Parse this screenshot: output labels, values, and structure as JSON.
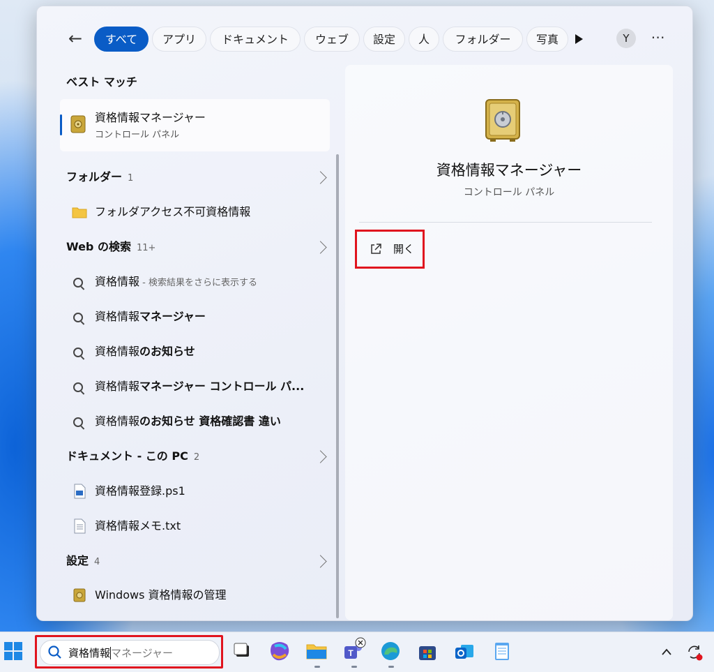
{
  "filters": {
    "back_label": "←",
    "chips": [
      "すべて",
      "アプリ",
      "ドキュメント",
      "ウェブ",
      "設定",
      "人",
      "フォルダー",
      "写真"
    ],
    "avatar": "Y",
    "more": "⋯"
  },
  "results": {
    "best_match_header": "ベスト マッチ",
    "best_match": {
      "name": "資格情報マネージャー",
      "sub": "コントロール パネル"
    },
    "folders": {
      "title": "フォルダー",
      "count": "1",
      "items": [
        "フォルダアクセス不可資格情報"
      ]
    },
    "web": {
      "title": "Web の検索",
      "count": "11+",
      "items": [
        {
          "term": "資格情報",
          "hint": " - 検索結果をさらに表示する"
        },
        {
          "term": "資格情報",
          "bold": "マネージャー"
        },
        {
          "term": "資格情報",
          "bold": "のお知らせ"
        },
        {
          "term": "資格情報",
          "bold": "マネージャー コントロール パ..."
        },
        {
          "term": "資格情報",
          "bold": "のお知らせ 資格確認書 違い"
        }
      ]
    },
    "documents": {
      "title": "ドキュメント - この PC",
      "count": "2",
      "items": [
        "資格情報登録.ps1",
        "資格情報メモ.txt"
      ]
    },
    "settings": {
      "title": "設定",
      "count": "4",
      "items": [
        "Windows 資格情報の管理"
      ]
    }
  },
  "detail": {
    "title": "資格情報マネージャー",
    "sub": "コントロール パネル",
    "open_label": "開く",
    "icon": "safe-icon"
  },
  "taskbar": {
    "search_typed": "資格情報",
    "search_suggest": "マネージャー",
    "icons": [
      "start-icon",
      "task-view-icon",
      "m365-copilot-icon",
      "file-explorer-icon",
      "teams-icon",
      "edge-icon",
      "store-icon",
      "outlook-icon",
      "notepad-icon"
    ]
  },
  "colors": {
    "accent": "#0a5cc6",
    "highlight": "#e0141e"
  }
}
